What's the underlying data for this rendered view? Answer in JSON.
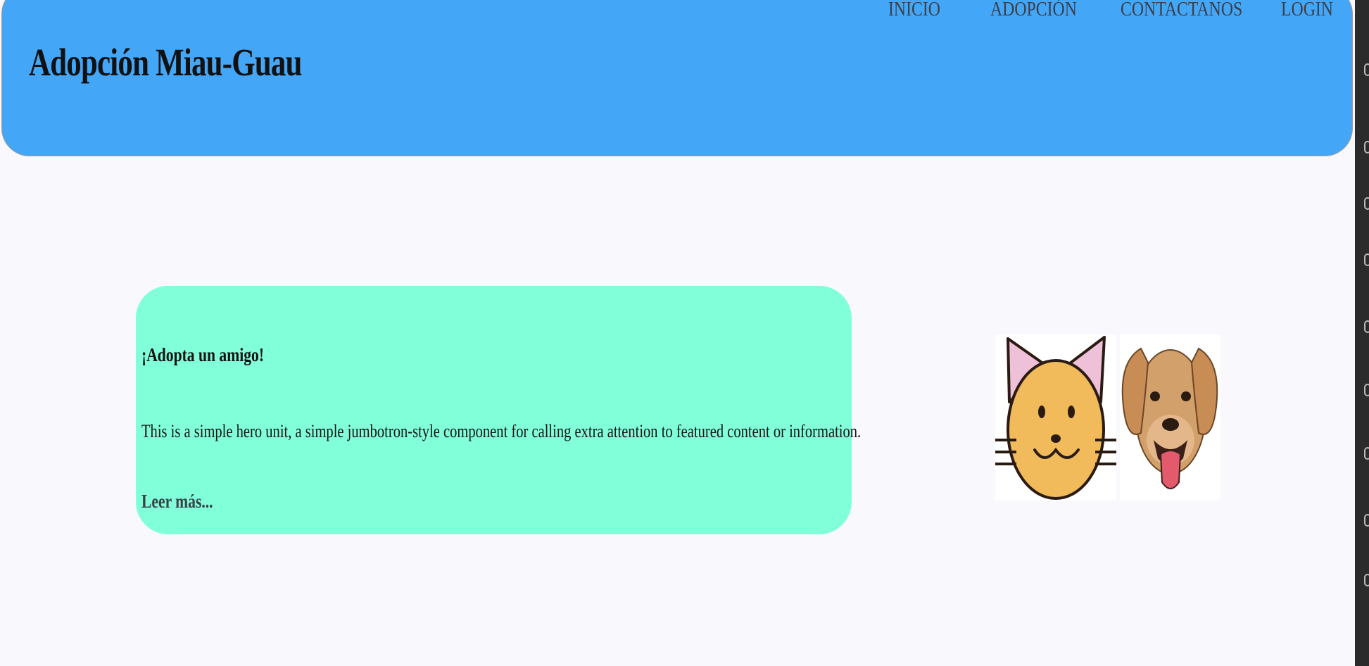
{
  "header": {
    "title": "Adopción Miau-Guau",
    "nav": [
      "INICIO",
      "ADOPCIÓN",
      "CONTACTANOS",
      "LOGIN"
    ]
  },
  "hero": {
    "title": "¡Adopta un amigo!",
    "text": "This is a simple hero unit, a simple jumbotron-style component for calling extra attention to featured content or information.",
    "link": "Leer más..."
  },
  "images": {
    "cat": "cat-face-illustration",
    "dog": "dog-face-illustration"
  },
  "colors": {
    "header_bg": "#44a6f7",
    "hero_bg": "#80ffd8",
    "page_bg": "#f8f8fd",
    "nav_text": "#3b3f48"
  }
}
